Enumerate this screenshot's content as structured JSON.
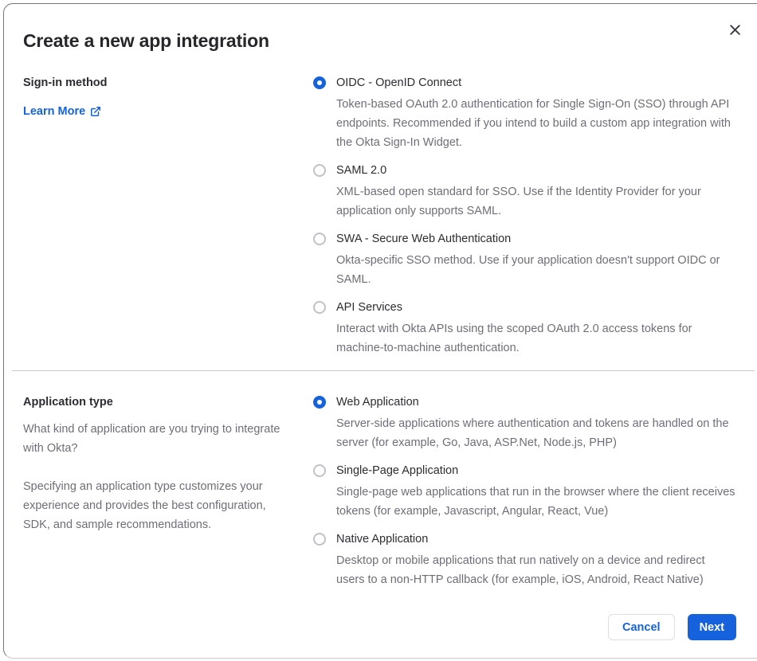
{
  "modal": {
    "title": "Create a new app integration"
  },
  "icons": {
    "close": "x-close",
    "external_link": "box-arrow-up-right"
  },
  "signin_section": {
    "label": "Sign-in method",
    "learn_more_label": "Learn More",
    "options": [
      {
        "label": "OIDC - OpenID Connect",
        "description": "Token-based OAuth 2.0 authentication for Single Sign-On (SSO) through API endpoints. Recommended if you intend to build a custom app integration with the Okta Sign-In Widget.",
        "selected": true
      },
      {
        "label": "SAML 2.0",
        "description": "XML-based open standard for SSO. Use if the Identity Provider for your application only supports SAML.",
        "selected": false
      },
      {
        "label": "SWA - Secure Web Authentication",
        "description": "Okta-specific SSO method. Use if your application doesn't support OIDC or SAML.",
        "selected": false
      },
      {
        "label": "API Services",
        "description": "Interact with Okta APIs using the scoped OAuth 2.0 access tokens for machine-to-machine authentication.",
        "selected": false
      }
    ]
  },
  "apptype_section": {
    "label": "Application type",
    "paragraph1": "What kind of application are you trying to integrate with Okta?",
    "paragraph2": "Specifying an application type customizes your experience and provides the best configuration, SDK, and sample recommendations.",
    "options": [
      {
        "label": "Web Application",
        "description": "Server-side applications where authentication and tokens are handled on the server (for example, Go, Java, ASP.Net, Node.js, PHP)",
        "selected": true
      },
      {
        "label": "Single-Page Application",
        "description": "Single-page web applications that run in the browser where the client receives tokens (for example, Javascript, Angular, React, Vue)",
        "selected": false
      },
      {
        "label": "Native Application",
        "description": "Desktop or mobile applications that run natively on a device and redirect users to a non-HTTP callback (for example, iOS, Android, React Native)",
        "selected": false
      }
    ]
  },
  "footer": {
    "cancel_label": "Cancel",
    "next_label": "Next"
  },
  "colors": {
    "accent_blue": "#1662dd",
    "text_dark": "#2c2c33",
    "text_gray": "#6e6e78"
  }
}
